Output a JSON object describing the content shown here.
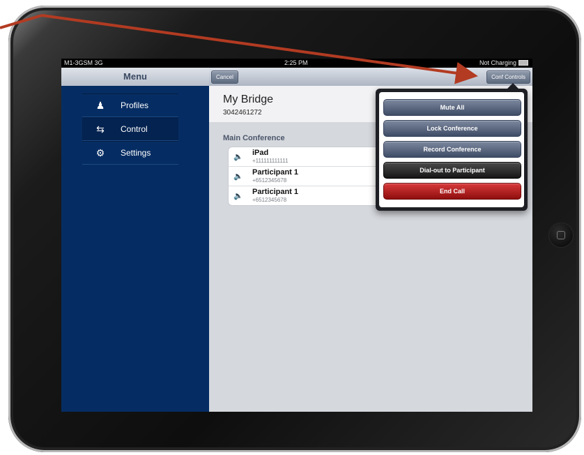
{
  "status_bar": {
    "carrier": "M1-3GSM 3G",
    "time": "2:25 PM",
    "battery": "Not Charging"
  },
  "sidebar": {
    "title": "Menu",
    "items": [
      {
        "label": "Profiles",
        "icon": "profiles-icon"
      },
      {
        "label": "Control",
        "icon": "control-icon"
      },
      {
        "label": "Settings",
        "icon": "gear-icon"
      }
    ]
  },
  "toolbar": {
    "cancel_label": "Cancel",
    "conf_controls_label": "Conf Controls"
  },
  "bridge": {
    "name": "My Bridge",
    "number": "3042461272"
  },
  "conference": {
    "title": "Main Conference",
    "participants": [
      {
        "name": "iPad",
        "phone": "+111111111111"
      },
      {
        "name": "Participant 1",
        "phone": "+6512345678"
      },
      {
        "name": "Participant 1",
        "phone": "+6512345678"
      }
    ]
  },
  "popover": {
    "buttons": [
      {
        "label": "Mute All",
        "style": "blue"
      },
      {
        "label": "Lock Conference",
        "style": "blue"
      },
      {
        "label": "Record Conference",
        "style": "blue"
      },
      {
        "label": "Dial-out to Participant",
        "style": "black"
      },
      {
        "label": "End Call",
        "style": "red"
      }
    ]
  },
  "colors": {
    "sidebar_bg": "#062d63",
    "annotation_arrow": "#b23b22",
    "end_call": "#b81b1b"
  }
}
